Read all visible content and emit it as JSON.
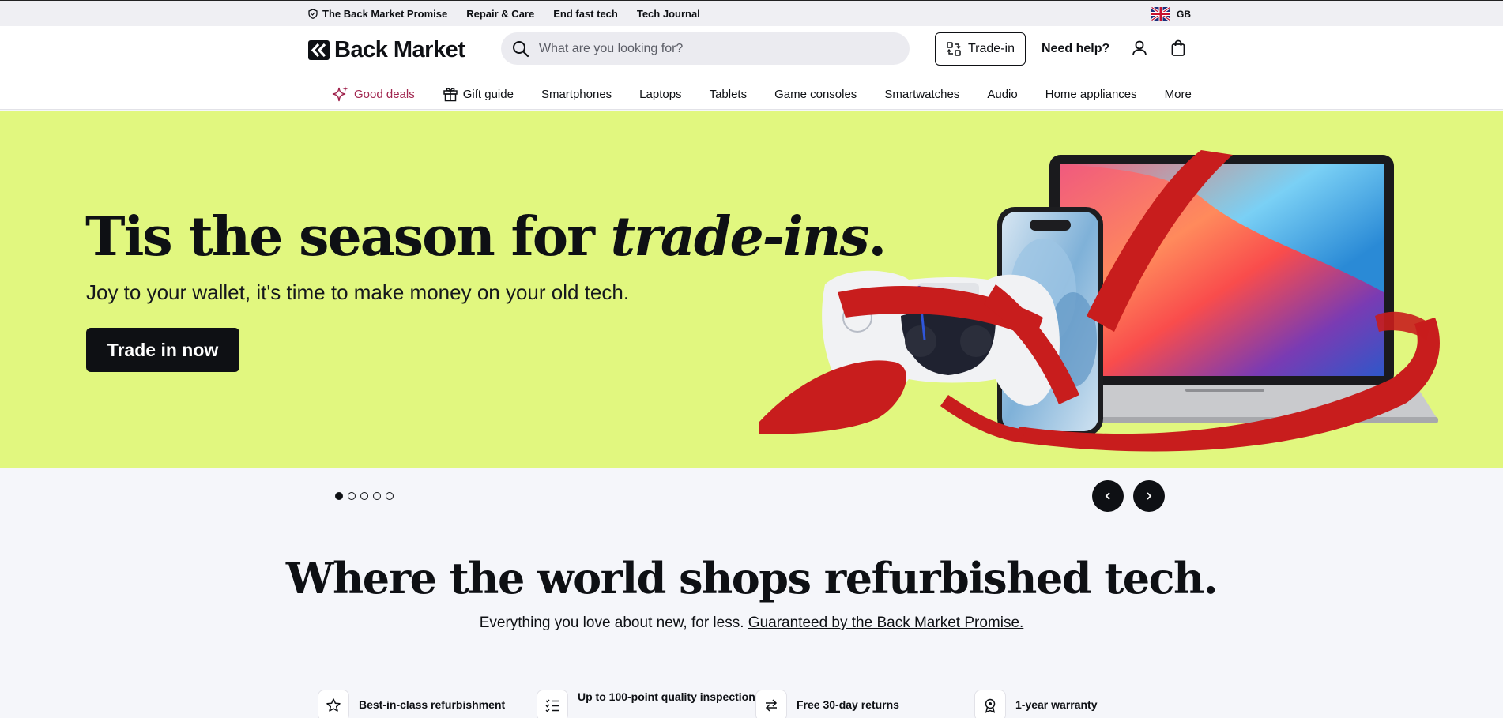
{
  "utility": {
    "links": [
      {
        "label": "The Back Market Promise",
        "icon": "shield-icon"
      },
      {
        "label": "Repair & Care"
      },
      {
        "label": "End fast tech"
      },
      {
        "label": "Tech Journal"
      }
    ],
    "locale": "GB"
  },
  "header": {
    "logo_text": "Back Market",
    "search_placeholder": "What are you looking for?",
    "tradein_label": "Trade-in",
    "help_label": "Need help?"
  },
  "nav": {
    "items": [
      {
        "label": "Good deals",
        "icon": "sparkle-icon"
      },
      {
        "label": "Gift guide",
        "icon": "gift-icon"
      },
      {
        "label": "Smartphones"
      },
      {
        "label": "Laptops"
      },
      {
        "label": "Tablets"
      },
      {
        "label": "Game consoles"
      },
      {
        "label": "Smartwatches"
      },
      {
        "label": "Audio"
      },
      {
        "label": "Home appliances"
      },
      {
        "label": "More"
      }
    ]
  },
  "hero": {
    "title_plain": "Tis the season for ",
    "title_italic": "trade-ins",
    "title_end": ".",
    "subtitle": "Joy to your wallet, it's time to make money on your old tech.",
    "cta_label": "Trade in now",
    "background": "#e1f77f",
    "slides_total": 5,
    "active_slide": 1
  },
  "section": {
    "heading": "Where the world shops refurbished tech.",
    "tagline": "Everything you love about new, for less. ",
    "tagline_link": "Guaranteed by the Back Market Promise."
  },
  "features": [
    {
      "label": "Best-in-class refurbishment",
      "icon": "star-icon"
    },
    {
      "label": "Up to 100-point quality inspection",
      "icon": "checklist-icon"
    },
    {
      "label": "Free 30-day returns",
      "icon": "swap-arrows-icon"
    },
    {
      "label": "1-year warranty",
      "icon": "award-icon"
    }
  ],
  "colors": {
    "accent_deals": "#a1264f",
    "ink": "#0e1014",
    "ribbon": "#c81d1d"
  }
}
